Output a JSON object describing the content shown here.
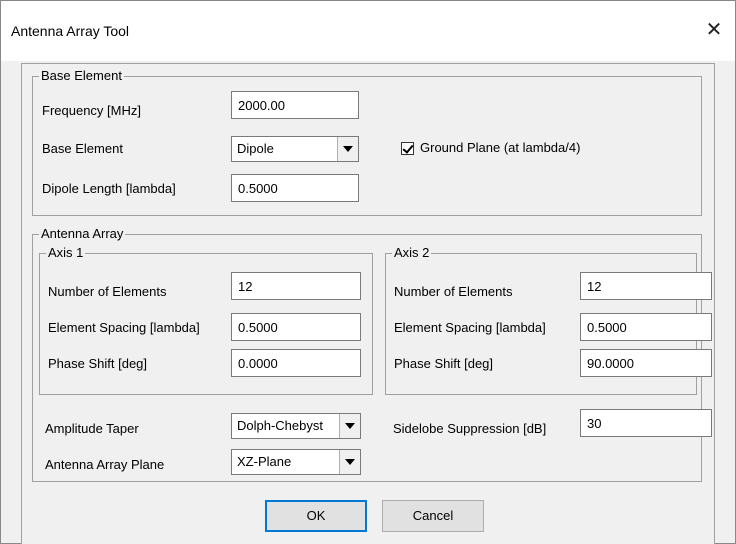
{
  "window": {
    "title": "Antenna Array Tool"
  },
  "base_element": {
    "legend": "Base Element",
    "frequency_label": "Frequency [MHz]",
    "frequency_value": "2000.00",
    "element_label": "Base Element",
    "element_value": "Dipole",
    "ground_plane_label": "Ground Plane (at lambda/4)",
    "ground_plane_checked": true,
    "dipole_length_label": "Dipole Length [lambda]",
    "dipole_length_value": "0.5000"
  },
  "antenna_array": {
    "legend": "Antenna Array",
    "axis1": {
      "legend": "Axis 1",
      "num_elements_label": "Number of Elements",
      "num_elements_value": "12",
      "spacing_label": "Element Spacing [lambda]",
      "spacing_value": "0.5000",
      "phase_label": "Phase Shift [deg]",
      "phase_value": "0.0000"
    },
    "axis2": {
      "legend": "Axis 2",
      "num_elements_label": "Number of Elements",
      "num_elements_value": "12",
      "spacing_label": "Element Spacing [lambda]",
      "spacing_value": "0.5000",
      "phase_label": "Phase Shift [deg]",
      "phase_value": "90.0000"
    },
    "taper_label": "Amplitude Taper",
    "taper_value": "Dolph-Chebyst",
    "sidelobe_label": "Sidelobe Suppression [dB]",
    "sidelobe_value": "30",
    "plane_label": "Antenna Array Plane",
    "plane_value": "XZ-Plane"
  },
  "buttons": {
    "ok": "OK",
    "cancel": "Cancel"
  }
}
